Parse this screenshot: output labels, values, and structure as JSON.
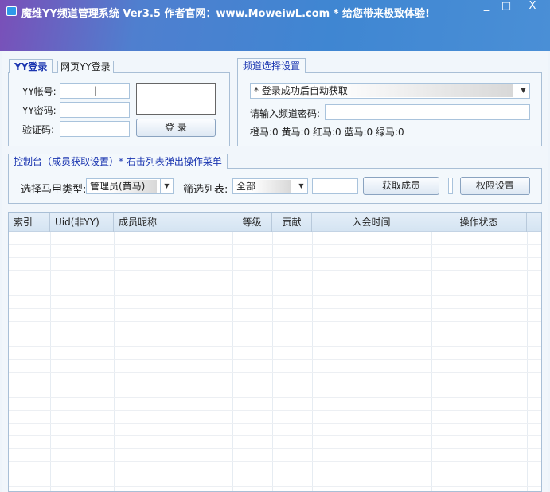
{
  "window": {
    "title": "魔维YY频道管理系统 Ver3.5  作者官网：www.MoweiwL.com  *  给您带来极致体验!",
    "minimize": "_",
    "maximize": "□",
    "close": "X"
  },
  "login": {
    "tabs": [
      "YY登录",
      "网页YY登录"
    ],
    "account_label": "YY帐号:",
    "password_label": "YY密码:",
    "captcha_label": "验证码:",
    "account_value": "|",
    "login_button": "登 录"
  },
  "channel": {
    "tab": "频道选择设置",
    "channel_select": "* 登录成功后自动获取",
    "password_label": "请输入频道密码:",
    "counts": "橙马:0 黄马:0 红马:0 蓝马:0 绿马:0"
  },
  "console": {
    "tab": "控制台（成员获取设置）* 右击列表弹出操作菜单",
    "role_label": "选择马甲类型:",
    "role_value": "管理员(黄马)",
    "filter_label": "筛选列表:",
    "filter_value": "全部",
    "fetch_button": "获取成员",
    "permission_button": "权限设置"
  },
  "table": {
    "columns": [
      "索引",
      "Uid(非YY)",
      "成员昵称",
      "等级",
      "贡献",
      "入会时间",
      "操作状态"
    ]
  }
}
